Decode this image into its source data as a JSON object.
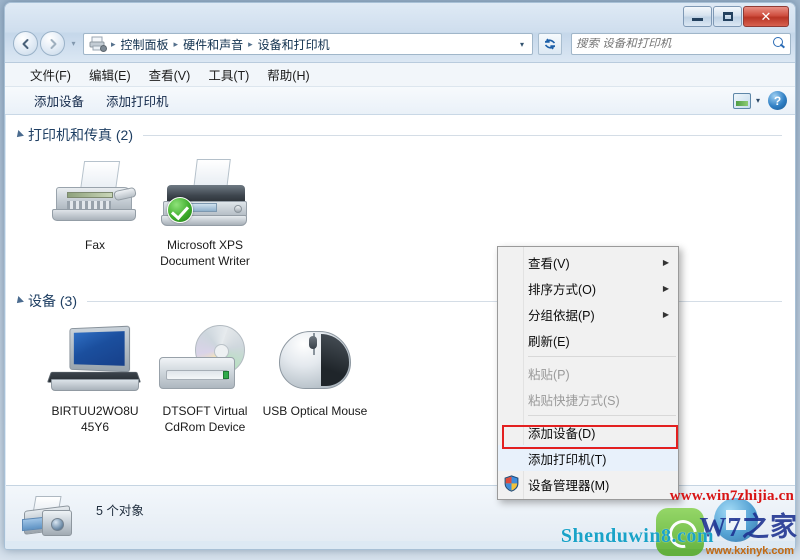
{
  "window": {
    "controls": {
      "minimize": "–",
      "maximize": "□",
      "close": "✕"
    }
  },
  "address": {
    "back_icon": "back-arrow",
    "forward_icon": "forward-arrow",
    "history_caret": "▾",
    "location_icon": "devices-printers-icon",
    "crumbs": [
      "控制面板",
      "硬件和声音",
      "设备和打印机"
    ],
    "separator": "▸",
    "dropdown_caret": "▾",
    "refresh_label": "↻",
    "search": {
      "placeholder": "搜索 设备和打印机",
      "value": "",
      "icon": "search-icon"
    }
  },
  "menubar": {
    "items": [
      "文件(F)",
      "编辑(E)",
      "查看(V)",
      "工具(T)",
      "帮助(H)"
    ]
  },
  "commandbar": {
    "buttons": [
      "添加设备",
      "添加打印机"
    ],
    "view_icon": "view-options-icon",
    "view_caret": "▾",
    "help_label": "?"
  },
  "content": {
    "groups": [
      {
        "title": "打印机和传真 (2)",
        "collapse_icon": "triangle-expanded",
        "items": [
          {
            "label": "Fax",
            "icon": "fax-machine-icon",
            "default_badge": false
          },
          {
            "label": "Microsoft XPS Document Writer",
            "icon": "printer-icon",
            "default_badge": true
          }
        ]
      },
      {
        "title": "设备 (3)",
        "collapse_icon": "triangle-expanded",
        "items": [
          {
            "label": "BIRTUU2WO8U 45Y6",
            "icon": "laptop-icon",
            "default_badge": false
          },
          {
            "label": "DTSOFT Virtual CdRom Device",
            "icon": "cd-drive-icon",
            "default_badge": false
          },
          {
            "label": "USB Optical Mouse",
            "icon": "mouse-icon",
            "default_badge": false
          }
        ]
      }
    ]
  },
  "statusbar": {
    "icon": "printer-camera-icon",
    "text": "5 个对象"
  },
  "context_menu": {
    "items": [
      {
        "label": "查看(V)",
        "submenu": true,
        "disabled": false,
        "icon": null,
        "separator_after": false,
        "highlighted": false
      },
      {
        "label": "排序方式(O)",
        "submenu": true,
        "disabled": false,
        "icon": null,
        "separator_after": false,
        "highlighted": false
      },
      {
        "label": "分组依据(P)",
        "submenu": true,
        "disabled": false,
        "icon": null,
        "separator_after": false,
        "highlighted": false
      },
      {
        "label": "刷新(E)",
        "submenu": false,
        "disabled": false,
        "icon": null,
        "separator_after": true,
        "highlighted": false
      },
      {
        "label": "粘贴(P)",
        "submenu": false,
        "disabled": true,
        "icon": null,
        "separator_after": false,
        "highlighted": false
      },
      {
        "label": "粘贴快捷方式(S)",
        "submenu": false,
        "disabled": true,
        "icon": null,
        "separator_after": true,
        "highlighted": false
      },
      {
        "label": "添加设备(D)",
        "submenu": false,
        "disabled": false,
        "icon": null,
        "separator_after": false,
        "highlighted": false
      },
      {
        "label": "添加打印机(T)",
        "submenu": false,
        "disabled": false,
        "icon": null,
        "separator_after": false,
        "highlighted": true
      },
      {
        "label": "设备管理器(M)",
        "submenu": false,
        "disabled": false,
        "icon": "uac-shield-icon",
        "separator_after": false,
        "highlighted": false
      }
    ],
    "submenu_arrow": "▶",
    "highlight_color": "#e32020"
  },
  "watermarks": {
    "line1": "www.win7zhijia.cn",
    "line2": "W7之家",
    "line3": "Shenduwin8.com",
    "line4": "www.kxinyk.com"
  },
  "colors": {
    "accent": "#1f3f63",
    "highlight": "#e32020",
    "default_badge": "#3fae2d",
    "title_close": "#b83525"
  }
}
